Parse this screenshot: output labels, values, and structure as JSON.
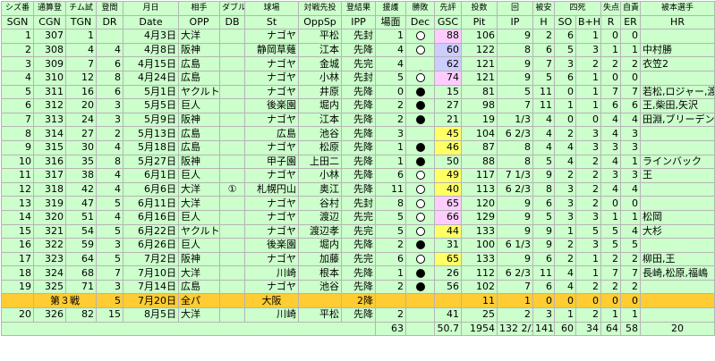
{
  "headers": {
    "top": [
      "シズ番",
      "通算登",
      "チム試",
      "登間",
      "月日",
      "相手",
      "ダブル",
      "球場",
      "対戦先投",
      "登結果",
      "援護",
      "勝敗",
      "先評",
      "投数",
      "回",
      "被安",
      "四死",
      "失点",
      "自責",
      "被本選手"
    ],
    "bottom": [
      "SGN",
      "CGN",
      "TGN",
      "DR",
      "Date",
      "OPP",
      "DB",
      "St",
      "OppSp",
      "IPP",
      "場面",
      "Dec",
      "GSC",
      "Pit",
      "IP",
      "H",
      "SO",
      "B+H",
      "R",
      "ER",
      "HR"
    ]
  },
  "rows": [
    {
      "sgn": "1",
      "cgn": "307",
      "tgn": "1",
      "dr": "",
      "date": "4月3日",
      "opp": "大洋",
      "db": "",
      "st": "ナゴヤ",
      "oppsp": "平松",
      "ipp": "先封",
      "rs": "1",
      "dec": "circle-o",
      "gsc": "88",
      "gsc_bg": "pink",
      "pit": "106",
      "ip": "9",
      "h": "2",
      "so": "6",
      "bh": "1",
      "r": "0",
      "er": "0",
      "hr": ""
    },
    {
      "sgn": "2",
      "cgn": "308",
      "tgn": "4",
      "dr": "4",
      "date": "4月8日",
      "opp": "阪神",
      "db": "",
      "st": "静岡草薙",
      "oppsp": "江本",
      "ipp": "先降",
      "rs": "4",
      "dec": "circle-o",
      "gsc": "60",
      "gsc_bg": "lav",
      "pit": "122",
      "ip": "8",
      "h": "6",
      "so": "5",
      "bh": "3",
      "r": "1",
      "er": "1",
      "hr": "中村勝"
    },
    {
      "sgn": "3",
      "cgn": "309",
      "tgn": "7",
      "dr": "6",
      "date": "4月15日",
      "opp": "広島",
      "db": "",
      "st": "ナゴヤ",
      "oppsp": "金城",
      "ipp": "先完",
      "rs": "4",
      "dec": "tri",
      "gsc": "62",
      "gsc_bg": "lav",
      "pit": "121",
      "ip": "9",
      "h": "7",
      "so": "3",
      "bh": "2",
      "r": "2",
      "er": "2",
      "hr": "衣笠2"
    },
    {
      "sgn": "4",
      "cgn": "310",
      "tgn": "12",
      "dr": "8",
      "date": "4月24日",
      "opp": "広島",
      "db": "",
      "st": "ナゴヤ",
      "oppsp": "小林",
      "ipp": "先封",
      "rs": "5",
      "dec": "circle-o",
      "gsc": "74",
      "gsc_bg": "pink",
      "pit": "121",
      "ip": "9",
      "h": "5",
      "so": "6",
      "bh": "1",
      "r": "0",
      "er": "0",
      "hr": ""
    },
    {
      "sgn": "5",
      "cgn": "311",
      "tgn": "16",
      "dr": "6",
      "date": "5月1日",
      "opp": "ヤクルト",
      "db": "",
      "st": "ナゴヤ",
      "oppsp": "井原",
      "ipp": "先降",
      "rs": "0",
      "dec": "circle-f",
      "gsc": "15",
      "gsc_bg": "",
      "pit": "81",
      "ip": "5",
      "h": "11",
      "so": "0",
      "bh": "1",
      "r": "7",
      "er": "7",
      "hr": "若松,ロジャー,渡辺進"
    },
    {
      "sgn": "6",
      "cgn": "312",
      "tgn": "20",
      "dr": "3",
      "date": "5月5日",
      "opp": "巨人",
      "db": "",
      "st": "後楽園",
      "oppsp": "堀内",
      "ipp": "先降",
      "rs": "2",
      "dec": "circle-f",
      "gsc": "27",
      "gsc_bg": "",
      "pit": "98",
      "ip": "7",
      "h": "11",
      "so": "1",
      "bh": "1",
      "r": "6",
      "er": "6",
      "hr": "王,柴田,矢沢"
    },
    {
      "sgn": "7",
      "cgn": "313",
      "tgn": "24",
      "dr": "3",
      "date": "5月9日",
      "opp": "阪神",
      "db": "",
      "st": "ナゴヤ",
      "oppsp": "江本",
      "ipp": "先降",
      "rs": "2",
      "dec": "circle-f",
      "gsc": "21",
      "gsc_bg": "",
      "pit": "19",
      "ip": "1/3",
      "h": "4",
      "so": "0",
      "bh": "0",
      "r": "4",
      "er": "4",
      "hr": "田淵,ブリーデン"
    },
    {
      "sgn": "8",
      "cgn": "314",
      "tgn": "27",
      "dr": "2",
      "date": "5月13日",
      "opp": "広島",
      "db": "",
      "st": "広島",
      "oppsp": "池谷",
      "ipp": "先降",
      "rs": "3",
      "dec": "",
      "gsc": "45",
      "gsc_bg": "yel",
      "pit": "104",
      "ip": "6 2/3",
      "h": "4",
      "so": "2",
      "bh": "3",
      "r": "4",
      "er": "3",
      "hr": ""
    },
    {
      "sgn": "9",
      "cgn": "315",
      "tgn": "30",
      "dr": "4",
      "date": "5月18日",
      "opp": "広島",
      "db": "",
      "st": "ナゴヤ",
      "oppsp": "松原",
      "ipp": "先降",
      "rs": "1",
      "dec": "circle-f",
      "gsc": "46",
      "gsc_bg": "yel",
      "pit": "87",
      "ip": "8",
      "h": "4",
      "so": "4",
      "bh": "3",
      "r": "3",
      "er": "3",
      "hr": ""
    },
    {
      "sgn": "10",
      "cgn": "316",
      "tgn": "35",
      "dr": "8",
      "date": "5月27日",
      "opp": "阪神",
      "db": "",
      "st": "甲子園",
      "oppsp": "上田二",
      "ipp": "先降",
      "rs": "1",
      "dec": "circle-f",
      "gsc": "50",
      "gsc_bg": "",
      "pit": "88",
      "ip": "8",
      "h": "5",
      "so": "4",
      "bh": "2",
      "r": "4",
      "er": "1",
      "hr": "ラインバック"
    },
    {
      "sgn": "11",
      "cgn": "317",
      "tgn": "38",
      "dr": "4",
      "date": "6月1日",
      "opp": "巨人",
      "db": "",
      "st": "ナゴヤ",
      "oppsp": "小林",
      "ipp": "先降",
      "rs": "6",
      "dec": "circle-o",
      "gsc": "49",
      "gsc_bg": "yel",
      "pit": "117",
      "ip": "7 1/3",
      "h": "9",
      "so": "2",
      "bh": "2",
      "r": "3",
      "er": "3",
      "hr": "王"
    },
    {
      "sgn": "12",
      "cgn": "318",
      "tgn": "42",
      "dr": "4",
      "date": "6月6日",
      "opp": "大洋",
      "db": "①",
      "st": "札幌円山",
      "oppsp": "奥江",
      "ipp": "先降",
      "rs": "11",
      "dec": "circle-o",
      "gsc": "40",
      "gsc_bg": "yel",
      "pit": "113",
      "ip": "6 2/3",
      "h": "8",
      "so": "3",
      "bh": "2",
      "r": "4",
      "er": "4",
      "hr": ""
    },
    {
      "sgn": "13",
      "cgn": "319",
      "tgn": "47",
      "dr": "5",
      "date": "6月11日",
      "opp": "大洋",
      "db": "",
      "st": "ナゴヤ",
      "oppsp": "谷村",
      "ipp": "先封",
      "rs": "8",
      "dec": "circle-o",
      "gsc": "65",
      "gsc_bg": "pink",
      "pit": "120",
      "ip": "9",
      "h": "6",
      "so": "3",
      "bh": "2",
      "r": "0",
      "er": "0",
      "hr": ""
    },
    {
      "sgn": "14",
      "cgn": "320",
      "tgn": "51",
      "dr": "4",
      "date": "6月16日",
      "opp": "巨人",
      "db": "",
      "st": "ナゴヤ",
      "oppsp": "渡辺",
      "ipp": "先完",
      "rs": "5",
      "dec": "circle-o",
      "gsc": "66",
      "gsc_bg": "pink",
      "pit": "129",
      "ip": "9",
      "h": "5",
      "so": "3",
      "bh": "3",
      "r": "1",
      "er": "1",
      "hr": "松岡"
    },
    {
      "sgn": "15",
      "cgn": "321",
      "tgn": "54",
      "dr": "5",
      "date": "6月22日",
      "opp": "ヤクルト",
      "db": "",
      "st": "ナゴヤ",
      "oppsp": "渡辺孝",
      "ipp": "先完",
      "rs": "5",
      "dec": "circle-o",
      "gsc": "44",
      "gsc_bg": "yel",
      "pit": "133",
      "ip": "9",
      "h": "9",
      "so": "1",
      "bh": "5",
      "r": "5",
      "er": "4",
      "hr": "大杉"
    },
    {
      "sgn": "16",
      "cgn": "322",
      "tgn": "59",
      "dr": "3",
      "date": "6月26日",
      "opp": "巨人",
      "db": "",
      "st": "後楽園",
      "oppsp": "堀内",
      "ipp": "先降",
      "rs": "2",
      "dec": "circle-f",
      "gsc": "31",
      "gsc_bg": "",
      "pit": "100",
      "ip": "6 1/3",
      "h": "9",
      "so": "2",
      "bh": "3",
      "r": "5",
      "er": "5",
      "hr": ""
    },
    {
      "sgn": "17",
      "cgn": "323",
      "tgn": "64",
      "dr": "5",
      "date": "7月2日",
      "opp": "阪神",
      "db": "",
      "st": "ナゴヤ",
      "oppsp": "加藤",
      "ipp": "先完",
      "rs": "6",
      "dec": "circle-o",
      "gsc": "65",
      "gsc_bg": "yel",
      "pit": "133",
      "ip": "9",
      "h": "6",
      "so": "2",
      "bh": "1",
      "r": "2",
      "er": "2",
      "hr": "柳田,王"
    },
    {
      "sgn": "18",
      "cgn": "324",
      "tgn": "68",
      "dr": "7",
      "date": "7月10日",
      "opp": "大洋",
      "db": "",
      "st": "川崎",
      "oppsp": "根本",
      "ipp": "先降",
      "rs": "1",
      "dec": "circle-f",
      "gsc": "26",
      "gsc_bg": "",
      "pit": "112",
      "ip": "6 2/3",
      "h": "11",
      "so": "4",
      "bh": "1",
      "r": "7",
      "er": "7",
      "hr": "長崎,松原,福嶋"
    },
    {
      "sgn": "19",
      "cgn": "325",
      "tgn": "71",
      "dr": "3",
      "date": "7月14日",
      "opp": "広島",
      "db": "",
      "st": "ナゴヤ",
      "oppsp": "池谷",
      "ipp": "先降",
      "rs": "2",
      "dec": "circle-f",
      "gsc": "56",
      "gsc_bg": "",
      "pit": "102",
      "ip": "7",
      "h": "6",
      "so": "4",
      "bh": "2",
      "r": "2",
      "er": "2",
      "hr": ""
    }
  ],
  "special": {
    "label": "第３戦",
    "dr": "5",
    "date": "7月20日",
    "opp": "全パ",
    "st": "大阪",
    "ipp": "2降",
    "pit": "11",
    "ip": "1",
    "h": "0",
    "so": "0",
    "bh": "0",
    "r": "0",
    "er": "0"
  },
  "row20": {
    "sgn": "20",
    "cgn": "326",
    "tgn": "82",
    "dr": "15",
    "date": "8月5日",
    "opp": "大洋",
    "st": "川崎",
    "oppsp": "平松",
    "ipp": "先降",
    "rs": "2",
    "gsc": "41",
    "pit": "25",
    "ip": "2",
    "h": "3",
    "so": "1",
    "bh": "2",
    "r": "1",
    "er": "1"
  },
  "totals": {
    "rs": "63",
    "gsc": "50.7",
    "pit": "1954",
    "ip": "132 2/3",
    "h": "141",
    "so": "60",
    "bh": "34",
    "r": "64",
    "er": "58",
    "hr": "20"
  },
  "colors": {
    "grid": "#ccffcc",
    "red": "#ff0000",
    "blue": "#0000ff",
    "pink": "#ffccff",
    "yellow": "#ffff66",
    "lavender": "#ccccff",
    "special": "#ffcc33"
  }
}
